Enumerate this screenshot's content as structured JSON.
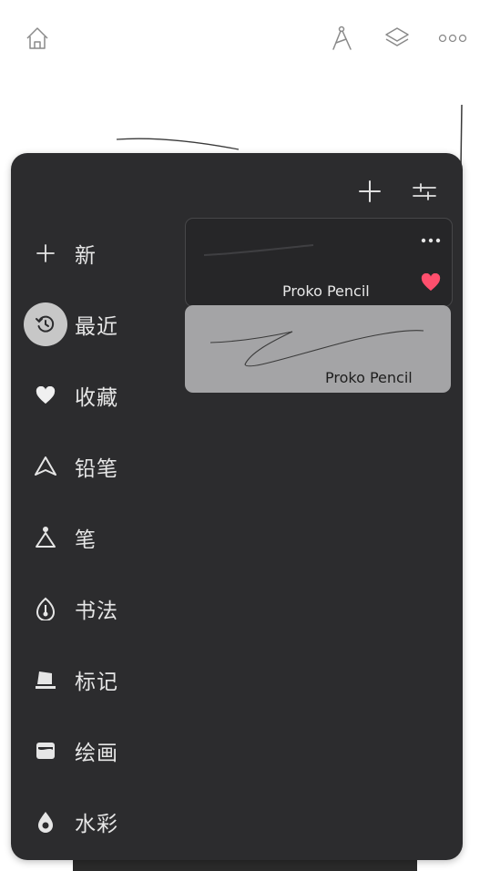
{
  "topbar": {
    "icons": [
      "home-icon",
      "compass-tool-icon",
      "layers-icon",
      "more-icon"
    ]
  },
  "panel": {
    "header_icons": [
      "add-icon",
      "settings-sliders-icon"
    ],
    "categories": [
      {
        "label": "新",
        "icon": "plus-icon",
        "active": false
      },
      {
        "label": "最近",
        "icon": "history-icon",
        "active": true
      },
      {
        "label": "收藏",
        "icon": "heart-icon",
        "active": false
      },
      {
        "label": "铅笔",
        "icon": "pencil-tip-icon",
        "active": false
      },
      {
        "label": "笔",
        "icon": "pen-nib-icon",
        "active": false
      },
      {
        "label": "书法",
        "icon": "calligraphy-icon",
        "active": false
      },
      {
        "label": "标记",
        "icon": "marker-icon",
        "active": false
      },
      {
        "label": "绘画",
        "icon": "paint-icon",
        "active": false
      },
      {
        "label": "水彩",
        "icon": "watercolor-drop-icon",
        "active": false
      }
    ],
    "brushes": [
      {
        "name": "Proko Pencil",
        "favorited": true,
        "selected": false
      },
      {
        "name": "Proko Pencil",
        "favorited": false,
        "selected": true
      }
    ]
  },
  "colors": {
    "panel_bg": "#2c2c2e",
    "selected_card_bg": "#a4a4a6",
    "favorite": "#ff4f6d",
    "active_icon_bg": "#c7c7c7"
  }
}
